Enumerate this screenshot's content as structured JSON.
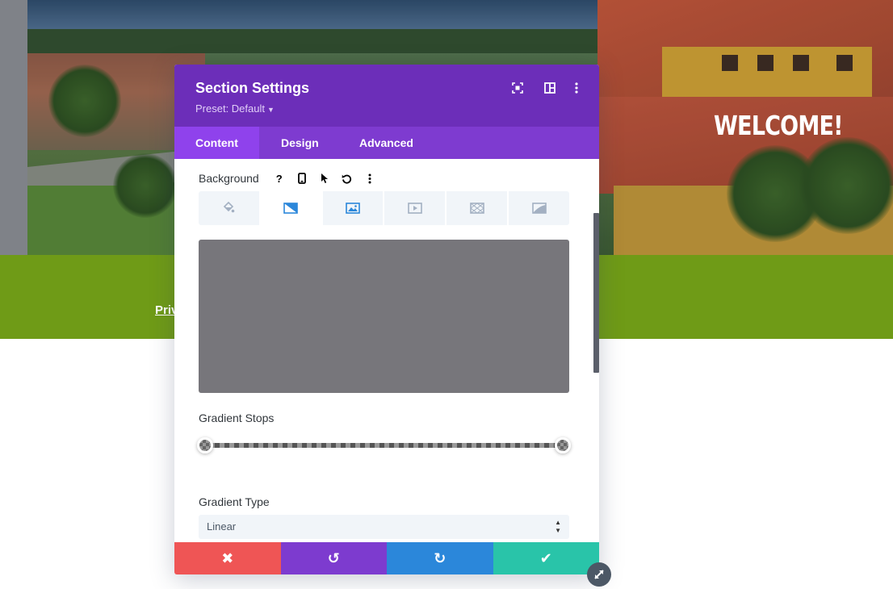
{
  "hero": {
    "headline": "WELCOME!"
  },
  "footer_band": {
    "link_text": "Priv"
  },
  "modal": {
    "title": "Section Settings",
    "preset_label": "Preset: Default",
    "header_icons": [
      "expand-icon",
      "split-view-icon",
      "more-options-icon"
    ],
    "tabs": [
      {
        "label": "Content",
        "active": true
      },
      {
        "label": "Design",
        "active": false
      },
      {
        "label": "Advanced",
        "active": false
      }
    ],
    "background": {
      "label": "Background",
      "option_icons": [
        "help-icon",
        "mobile-icon",
        "hover-cursor-icon",
        "reset-icon",
        "more-options-icon"
      ],
      "type_tabs": [
        "color-icon",
        "gradient-icon",
        "image-icon",
        "video-icon",
        "pattern-icon",
        "mask-icon"
      ],
      "active_type": "gradient-icon",
      "preview_color": "#77767b"
    },
    "gradient_stops": {
      "label": "Gradient Stops",
      "stops": [
        0,
        100
      ]
    },
    "gradient_type": {
      "label": "Gradient Type",
      "value": "Linear"
    },
    "footer_buttons": {
      "cancel": "✖",
      "undo": "↺",
      "redo": "↻",
      "save": "✔"
    }
  },
  "colors": {
    "header": "#6c2eb9",
    "tabs": "#7e3bd0",
    "active_tab": "#8f42ec",
    "cancel": "#ef5555",
    "undo": "#7d3bcf",
    "redo": "#2b87da",
    "save": "#29c4a9",
    "green_band": "#6f9b17"
  }
}
